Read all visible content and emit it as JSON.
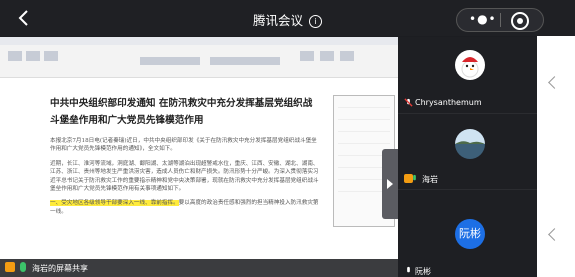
{
  "topbar": {
    "title": "腾讯会议",
    "info_icon": "info-icon",
    "more_icon": "more-dots-icon",
    "record_icon": "record-target-icon"
  },
  "shared_screen": {
    "document": {
      "heading": "中共中央组织部印发通知 在防汛救灾中充分发挥基层党组织战斗堡垒作用和广大党员先锋模范作用",
      "para1": "本报北京7月18日电(记者秦瑞)近日，中共中央组织部印发《关于在防汛救灾中充分发挥基层党组织战斗堡垒作用和广大党员先锋模范作用的通知》，全文如下。",
      "para2": "近期，长江、淮河等流域，洞庭湖、鄱阳湖、太湖等湖泊出现超警戒水位，重庆、江西、安徽、湖北、湖南、江苏、浙江、贵州等地发生严重洪涝灾害，造成人员伤亡和财产损失。防汛形势十分严峻。为深入贯彻落实习近平总书记关于防汛救灾工作的重要指示精神和党中央决策部署，现就在防汛救灾中充分发挥基层党组织战斗堡垒作用和广大党员先锋模范作用有关事项通知如下。",
      "para3_highlight": "一、受灾地区各级领导干部要深入一线、靠前指挥。",
      "para3_rest": "要以高度的政治责任感和强烈的担当精神投入防汛救灾第一线。"
    },
    "bottom_label": "海岩的屏幕共享"
  },
  "participants": [
    {
      "name": "Chrysanthemum"
    },
    {
      "name": "海岩"
    },
    {
      "name": "阮彬",
      "avatar_text": "阮彬"
    }
  ],
  "colors": {
    "accent_blue": "#1d6fe5",
    "mic_green": "#3cc36a",
    "user_orange": "#f39c12",
    "highlight_yellow": "#ffeb3b"
  }
}
